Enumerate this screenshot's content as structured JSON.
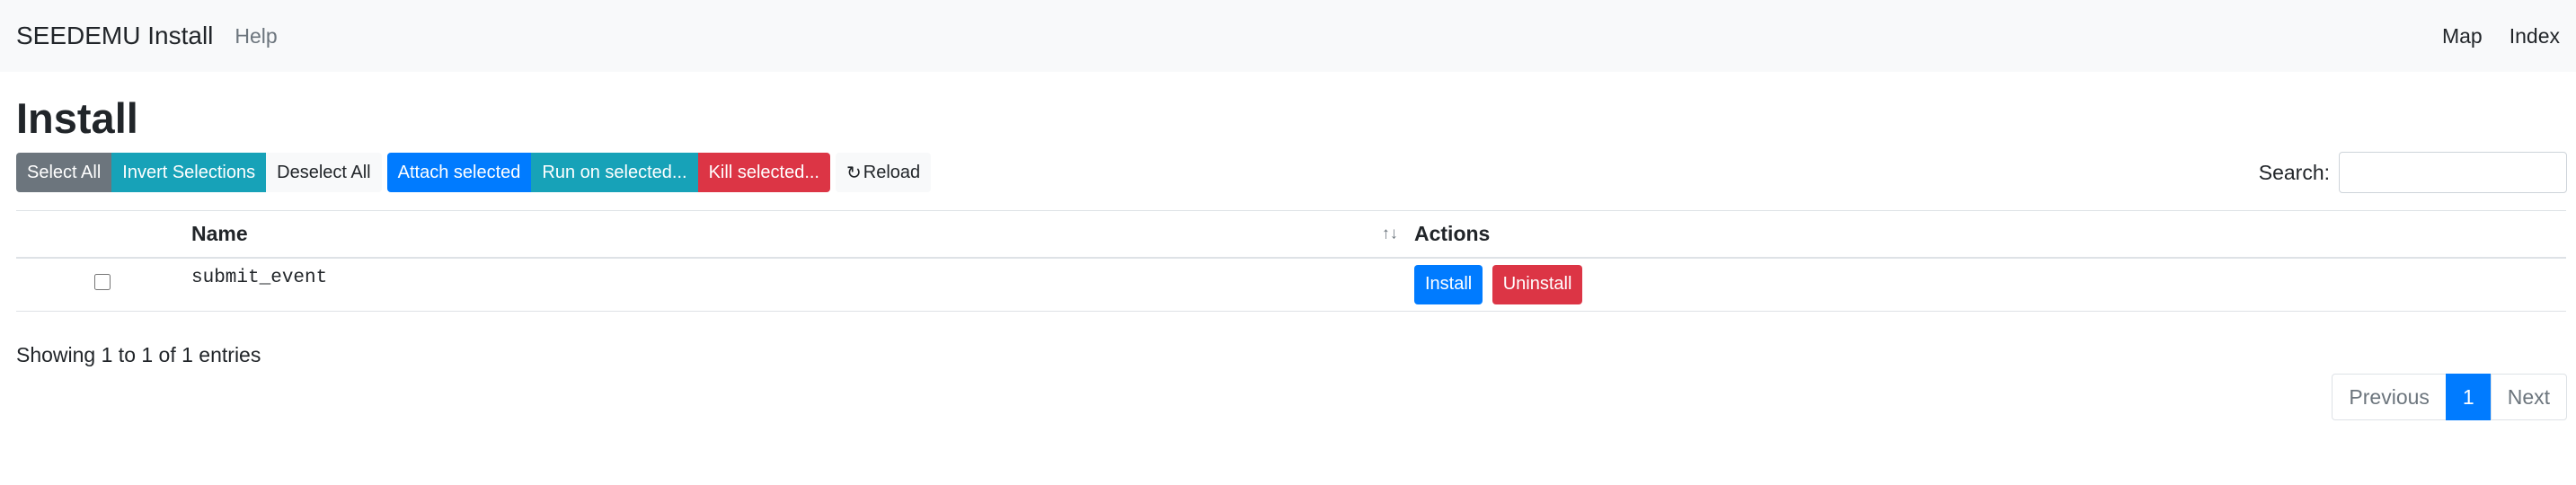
{
  "navbar": {
    "brand": "SEEDEMU Install",
    "help": "Help",
    "right_links": [
      "Map",
      "Index"
    ]
  },
  "page": {
    "title": "Install"
  },
  "toolbar": {
    "select_all": "Select All",
    "invert_selections": "Invert Selections",
    "deselect_all": "Deselect All",
    "attach_selected": "Attach selected",
    "run_on_selected": "Run on selected...",
    "kill_selected": "Kill selected...",
    "reload": "Reload",
    "reload_icon": "refresh-icon"
  },
  "search": {
    "label": "Search:",
    "value": "",
    "placeholder": ""
  },
  "table": {
    "columns": [
      "",
      "Name",
      "Actions"
    ],
    "sort_icon": "sort-icon",
    "rows": [
      {
        "checked": false,
        "name": "submit_event",
        "actions": [
          "Install",
          "Uninstall"
        ]
      }
    ]
  },
  "info": "Showing 1 to 1 of 1 entries",
  "pagination": {
    "previous": "Previous",
    "current": "1",
    "next": "Next"
  },
  "colors": {
    "primary": "#007bff",
    "danger": "#dc3545",
    "info": "#17a2b8",
    "secondary": "#6c757d",
    "light": "#f8f9fa"
  }
}
